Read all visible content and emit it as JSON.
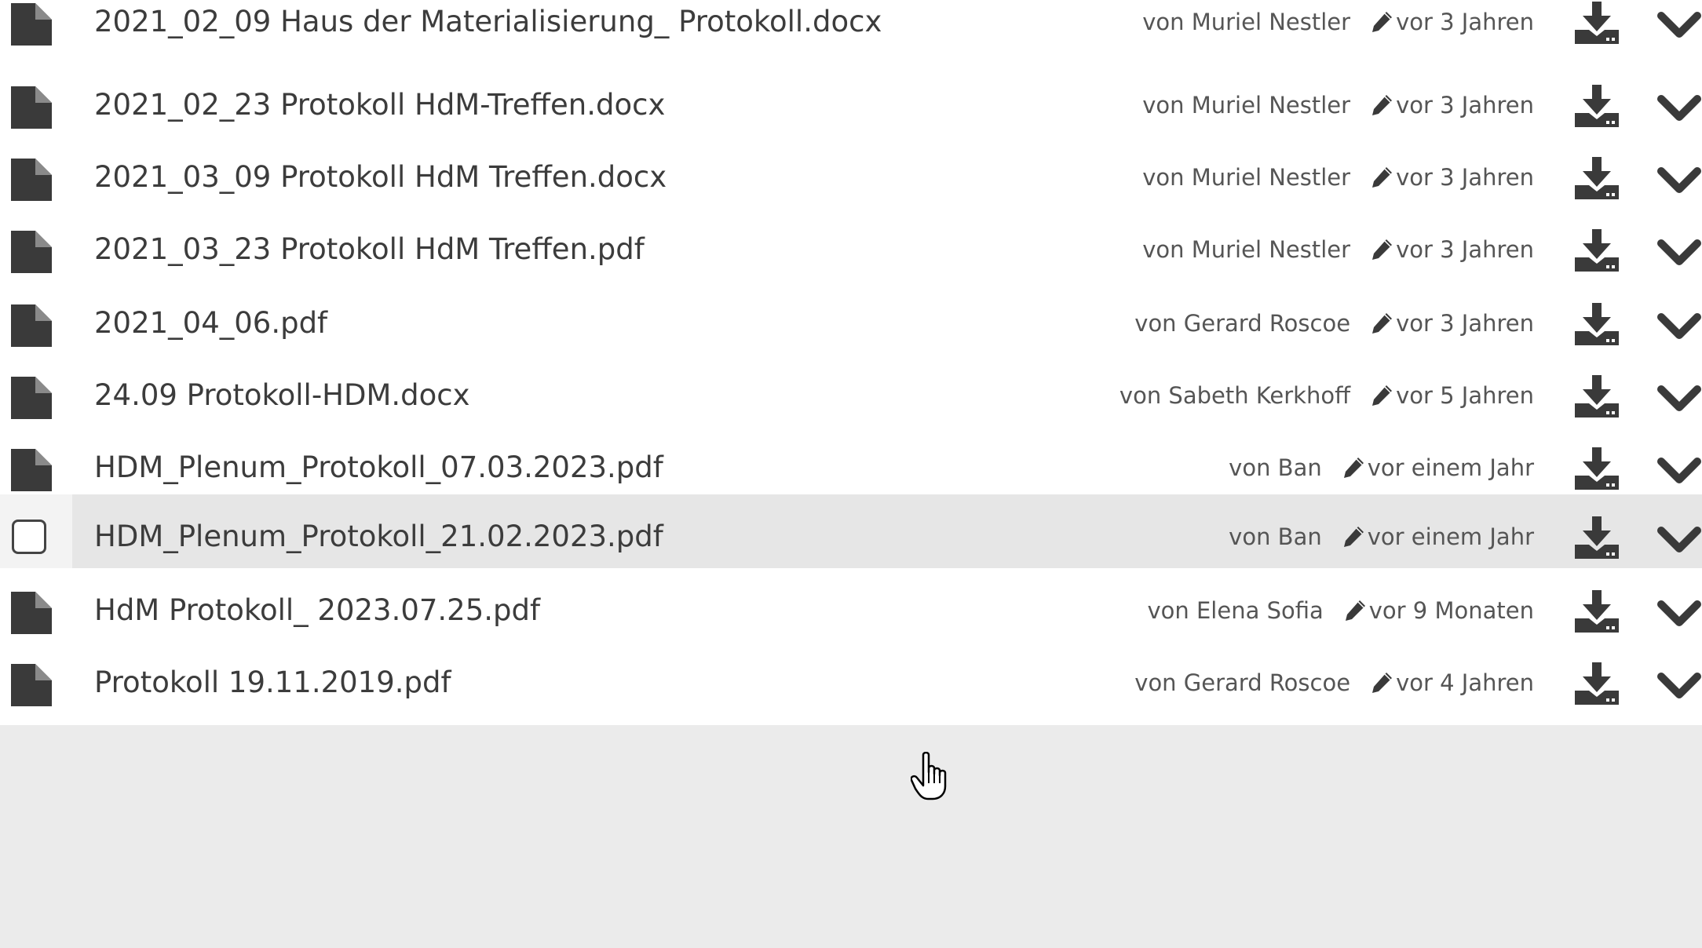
{
  "files": [
    {
      "name": "2021_02_09 Haus der Materialisierung_ Protokoll.docx",
      "author": "von Muriel Nestler",
      "modified": "vor 3 Jahren",
      "icon": "file-icon",
      "hovered": false
    },
    {
      "name": "2021_02_23 Protokoll HdM-Treffen.docx",
      "author": "von Muriel Nestler",
      "modified": "vor 3 Jahren",
      "icon": "file-icon",
      "hovered": false
    },
    {
      "name": "2021_03_09 Protokoll HdM Treffen.docx",
      "author": "von Muriel Nestler",
      "modified": "vor 3 Jahren",
      "icon": "file-icon",
      "hovered": false
    },
    {
      "name": "2021_03_23 Protokoll HdM Treffen.pdf",
      "author": "von Muriel Nestler",
      "modified": "vor 3 Jahren",
      "icon": "file-icon",
      "hovered": false
    },
    {
      "name": "2021_04_06.pdf",
      "author": "von Gerard Roscoe",
      "modified": "vor 3 Jahren",
      "icon": "file-icon",
      "hovered": false
    },
    {
      "name": "24.09 Protokoll-HDM.docx",
      "author": "von Sabeth Kerkhoff",
      "modified": "vor 5 Jahren",
      "icon": "file-icon",
      "hovered": false
    },
    {
      "name": "HDM_Plenum_Protokoll_07.03.2023.pdf",
      "author": "von Ban",
      "modified": "vor einem Jahr",
      "icon": "file-icon",
      "hovered": false
    },
    {
      "name": "HDM_Plenum_Protokoll_21.02.2023.pdf",
      "author": "von Ban",
      "modified": "vor einem Jahr",
      "icon": "checkbox-icon",
      "hovered": true
    },
    {
      "name": "HdM Protokoll_ 2023.07.25.pdf",
      "author": "von Elena Sofia",
      "modified": "vor 9 Monaten",
      "icon": "file-icon",
      "hovered": false
    },
    {
      "name": "Protokoll 19.11.2019.pdf",
      "author": "von Gerard Roscoe",
      "modified": "vor 4 Jahren",
      "icon": "file-icon",
      "hovered": false
    }
  ],
  "icons": {
    "file": "file-icon",
    "edit": "pencil-icon",
    "download": "download-icon",
    "expand": "chevron-down-icon",
    "select": "checkbox-icon",
    "cursor": "hand-pointer-icon"
  },
  "colors": {
    "row_background": "#ffffff",
    "row_hover_background": "#e6e6e6",
    "list_background": "#ebebeb",
    "text": "#3c3c3c",
    "meta_text": "#555555",
    "icon": "#3a3a3a"
  }
}
